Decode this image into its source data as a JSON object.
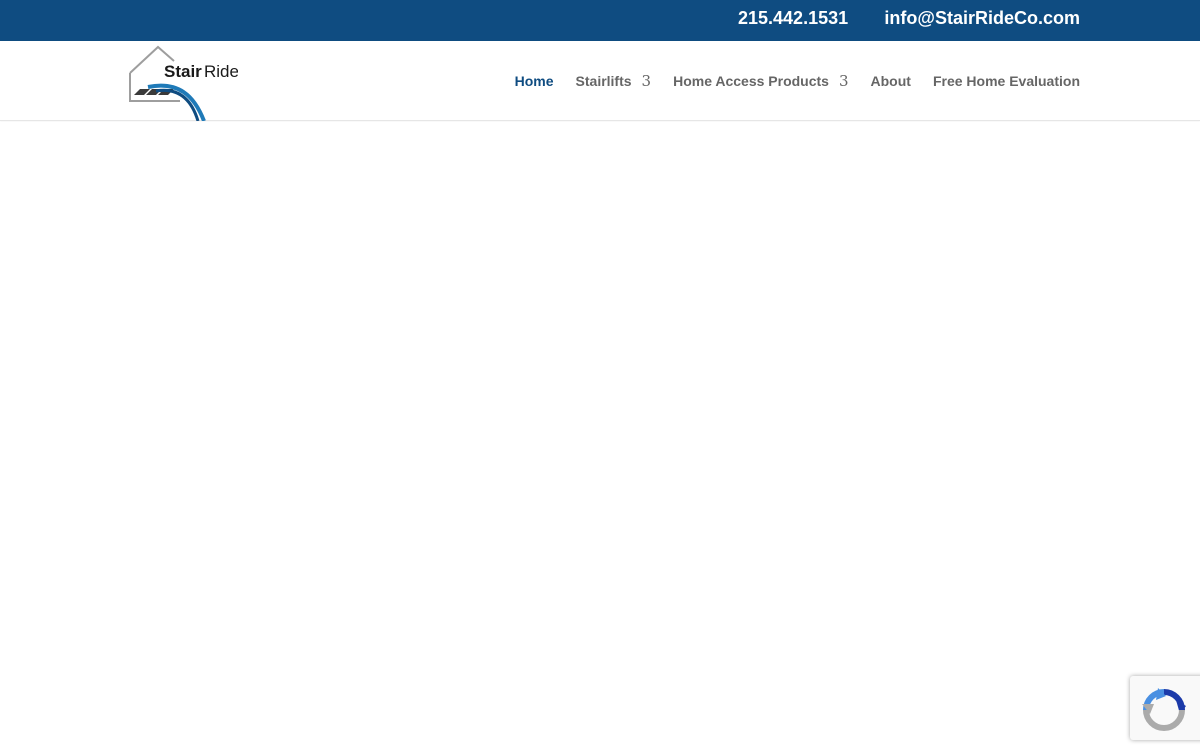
{
  "topbar": {
    "phone": "215.442.1531",
    "email": "info@StairRideCo.com",
    "background_color": "#0f4c81"
  },
  "logo": {
    "text_stair": "Stair",
    "text_ride": "Ride"
  },
  "nav": {
    "items": [
      {
        "label": "Home",
        "active": true
      },
      {
        "label": "Stairlifts",
        "has_dropdown": true,
        "dropdown_icon": "3"
      },
      {
        "label": "Home Access Products",
        "has_dropdown": true,
        "dropdown_icon": "3"
      },
      {
        "label": "About"
      },
      {
        "label": "Free Home Evaluation"
      }
    ],
    "active_color": "#0f4c81",
    "text_color": "#666666"
  },
  "recaptcha": {
    "icon": "recaptcha-icon"
  }
}
